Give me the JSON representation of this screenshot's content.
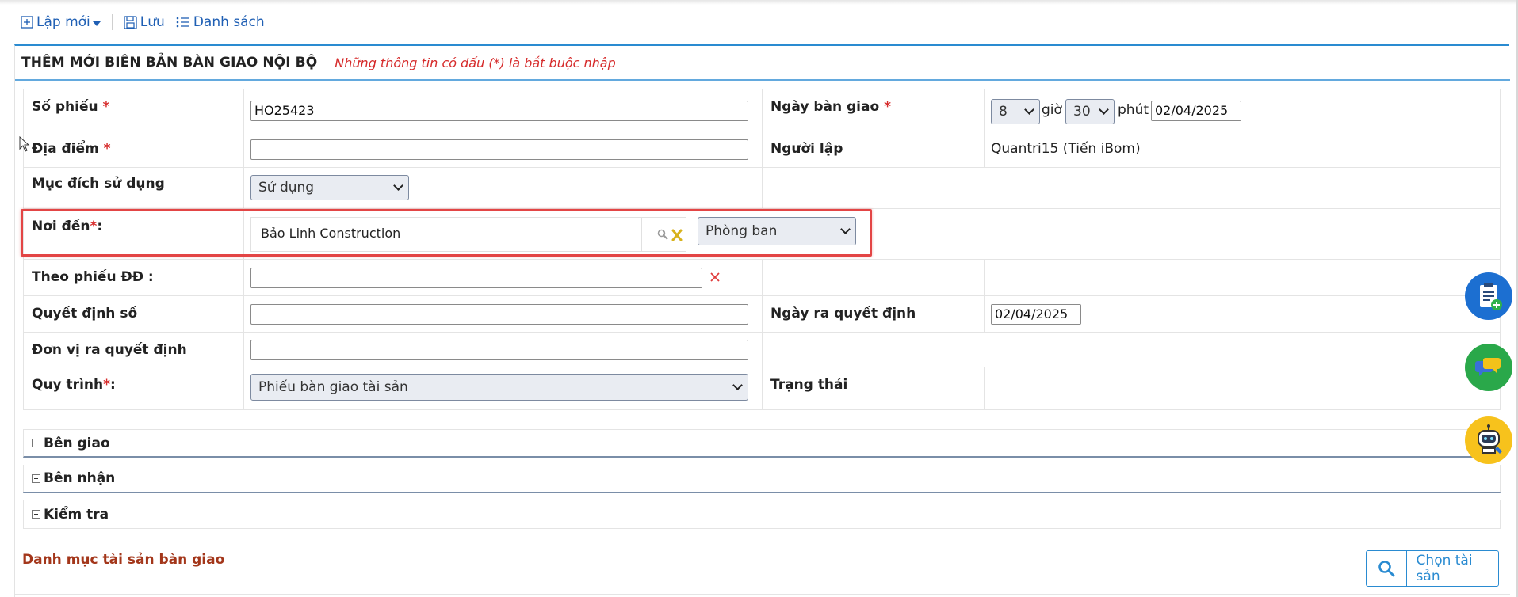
{
  "toolbar": {
    "new_label": "Lập mới",
    "save_label": "Lưu",
    "list_label": "Danh sách"
  },
  "panel": {
    "title": "THÊM MỚI BIÊN BẢN BÀN GIAO NỘI BỘ",
    "note": "Những thông tin có dấu (*) là bắt buộc nhập"
  },
  "form": {
    "so_phieu_label": "Số phiếu",
    "so_phieu_value": "HO25423",
    "ngay_ban_giao_label": "Ngày bàn giao",
    "hour_value": "8",
    "hour_suffix": "giờ",
    "minute_value": "30",
    "minute_suffix": "phút",
    "handover_date": "02/04/2025",
    "dia_diem_label": "Địa điểm",
    "dia_diem_value": "",
    "nguoi_lap_label": "Người lập",
    "nguoi_lap_value": "Quantri15 (Tiến iBom)",
    "muc_dich_label": "Mục đích sử dụng",
    "muc_dich_value": "Sử dụng",
    "noi_den_label": "Nơi đến",
    "noi_den_value": "Bảo Linh Construction",
    "noi_den_type": "Phòng ban",
    "theo_phieu_label": "Theo phiếu ĐĐ :",
    "theo_phieu_value": "",
    "quyet_dinh_label": "Quyết định số",
    "quyet_dinh_value": "",
    "ngay_ra_qd_label": "Ngày ra quyết định",
    "ngay_ra_qd_value": "02/04/2025",
    "don_vi_label": "Đơn vị ra quyết định",
    "don_vi_value": "",
    "quy_trinh_label": "Quy trình",
    "quy_trinh_value": "Phiếu bàn giao tài sản",
    "trang_thai_label": "Trạng thái",
    "required_mark": "*",
    "colon": ":"
  },
  "sections": {
    "ben_giao": "Bên giao",
    "ben_nhan": "Bên nhận",
    "kiem_tra": "Kiểm tra"
  },
  "assets": {
    "title": "Danh mục tài sản bàn giao",
    "choose_label": "Chọn tài sản"
  },
  "colors": {
    "accent": "#2a8bd1",
    "link": "#1f5fb4",
    "required": "#d62b2b",
    "highlight": "#e34545",
    "section_title": "#a3361a"
  }
}
